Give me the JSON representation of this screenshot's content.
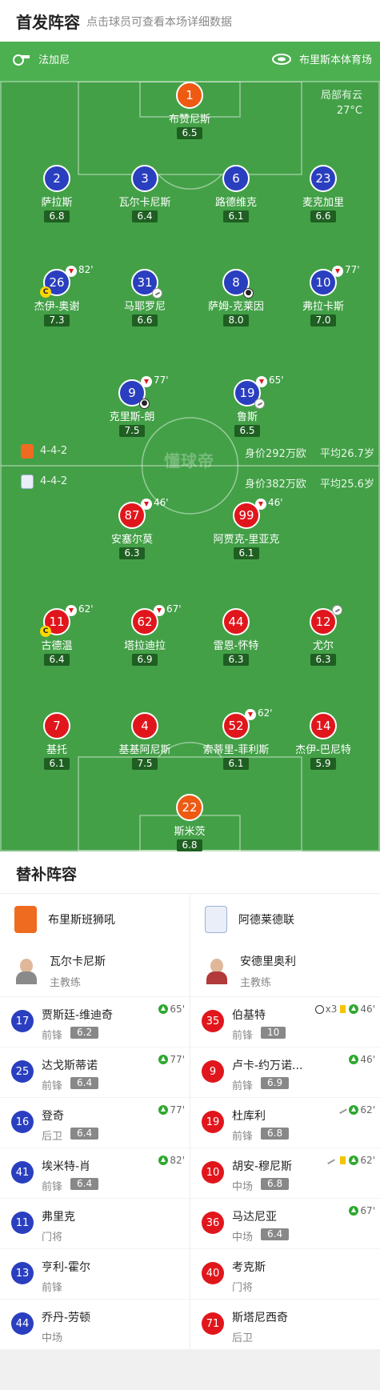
{
  "header": {
    "title": "首发阵容",
    "subtitle": "点击球员可查看本场详细数据"
  },
  "match_info": {
    "referee": "法加尼",
    "venue": "布里斯本体育场",
    "weather": "局部有云",
    "temperature": "27°C"
  },
  "home_team": {
    "name": "布里斯班狮吼",
    "formation": "4-4-2",
    "value": "身价292万欧",
    "avg_age": "平均26.7岁",
    "color": "#2a3fbf",
    "players": [
      {
        "num": "1",
        "name": "布赞尼斯",
        "rating": "6.5"
      },
      {
        "num": "2",
        "name": "萨拉斯",
        "rating": "6.8"
      },
      {
        "num": "3",
        "name": "瓦尔卡尼斯",
        "rating": "6.4"
      },
      {
        "num": "6",
        "name": "路德维克",
        "rating": "6.1"
      },
      {
        "num": "23",
        "name": "麦克加里",
        "rating": "6.6"
      },
      {
        "num": "26",
        "name": "杰伊-奥谢",
        "rating": "7.3",
        "sub_minute": "82'",
        "captain": "C"
      },
      {
        "num": "31",
        "name": "马耶罗尼",
        "rating": "6.6"
      },
      {
        "num": "8",
        "name": "萨姆-克莱因",
        "rating": "8.0"
      },
      {
        "num": "10",
        "name": "弗拉卡斯",
        "rating": "7.0",
        "sub_minute": "77'"
      },
      {
        "num": "9",
        "name": "克里斯-朗",
        "rating": "7.5",
        "sub_minute": "77'"
      },
      {
        "num": "19",
        "name": "鲁斯",
        "rating": "6.5",
        "sub_minute": "65'"
      }
    ]
  },
  "away_team": {
    "name": "阿德莱德联",
    "formation": "4-4-2",
    "value": "身价382万欧",
    "avg_age": "平均25.6岁",
    "color": "#e0161c",
    "players": [
      {
        "num": "87",
        "name": "安塞尔莫",
        "rating": "6.3",
        "sub_minute": "46'"
      },
      {
        "num": "99",
        "name": "阿贾克-里亚克",
        "rating": "6.1",
        "sub_minute": "46'"
      },
      {
        "num": "11",
        "name": "古德温",
        "rating": "6.4",
        "sub_minute": "62'",
        "captain": "C"
      },
      {
        "num": "62",
        "name": "塔拉迪拉",
        "rating": "6.9",
        "sub_minute": "67'"
      },
      {
        "num": "44",
        "name": "雷恩-怀特",
        "rating": "6.3"
      },
      {
        "num": "12",
        "name": "尤尔",
        "rating": "6.3"
      },
      {
        "num": "7",
        "name": "基托",
        "rating": "6.1"
      },
      {
        "num": "4",
        "name": "基基阿尼斯",
        "rating": "7.5"
      },
      {
        "num": "52",
        "name": "索蒂里-菲利斯",
        "rating": "6.1",
        "sub_minute": "62'"
      },
      {
        "num": "14",
        "name": "杰伊-巴尼特",
        "rating": "5.9"
      },
      {
        "num": "22",
        "name": "斯米茨",
        "rating": "6.8"
      }
    ]
  },
  "watermark": "懂球帝",
  "subs": {
    "title": "替补阵容",
    "role_label": "主教练",
    "home": {
      "team": "布里斯班狮吼",
      "coach": "瓦尔卡尼斯",
      "players": [
        {
          "num": "17",
          "name": "贾斯廷-维迪奇",
          "pos": "前锋",
          "rating": "6.2",
          "events": "65'"
        },
        {
          "num": "25",
          "name": "达戈斯蒂诺",
          "pos": "前锋",
          "rating": "6.4",
          "events": "77'"
        },
        {
          "num": "16",
          "name": "登奇",
          "pos": "后卫",
          "rating": "6.4",
          "events": "77'"
        },
        {
          "num": "41",
          "name": "埃米特-肖",
          "pos": "前锋",
          "rating": "6.4",
          "events": "82'"
        },
        {
          "num": "11",
          "name": "弗里克",
          "pos": "门将",
          "rating": "",
          "events": ""
        },
        {
          "num": "13",
          "name": "亨利-霍尔",
          "pos": "前锋",
          "rating": "",
          "events": ""
        },
        {
          "num": "44",
          "name": "乔丹-劳顿",
          "pos": "中场",
          "rating": "",
          "events": ""
        }
      ]
    },
    "away": {
      "team": "阿德莱德联",
      "coach": "安德里奥利",
      "players": [
        {
          "num": "35",
          "name": "伯基特",
          "pos": "前锋",
          "rating": "10",
          "goals": "x3",
          "events": "46'"
        },
        {
          "num": "9",
          "name": "卢卡-约万诺...",
          "pos": "前锋",
          "rating": "6.9",
          "events": "46'"
        },
        {
          "num": "19",
          "name": "杜库利",
          "pos": "前锋",
          "rating": "6.8",
          "events": "62'"
        },
        {
          "num": "10",
          "name": "胡安-穆尼斯",
          "pos": "中场",
          "rating": "6.8",
          "events": "62'"
        },
        {
          "num": "36",
          "name": "马达尼亚",
          "pos": "中场",
          "rating": "6.4",
          "events": "67'"
        },
        {
          "num": "40",
          "name": "考克斯",
          "pos": "门将",
          "rating": "",
          "events": ""
        },
        {
          "num": "71",
          "name": "斯塔尼西奇",
          "pos": "后卫",
          "rating": "",
          "events": ""
        }
      ]
    }
  }
}
